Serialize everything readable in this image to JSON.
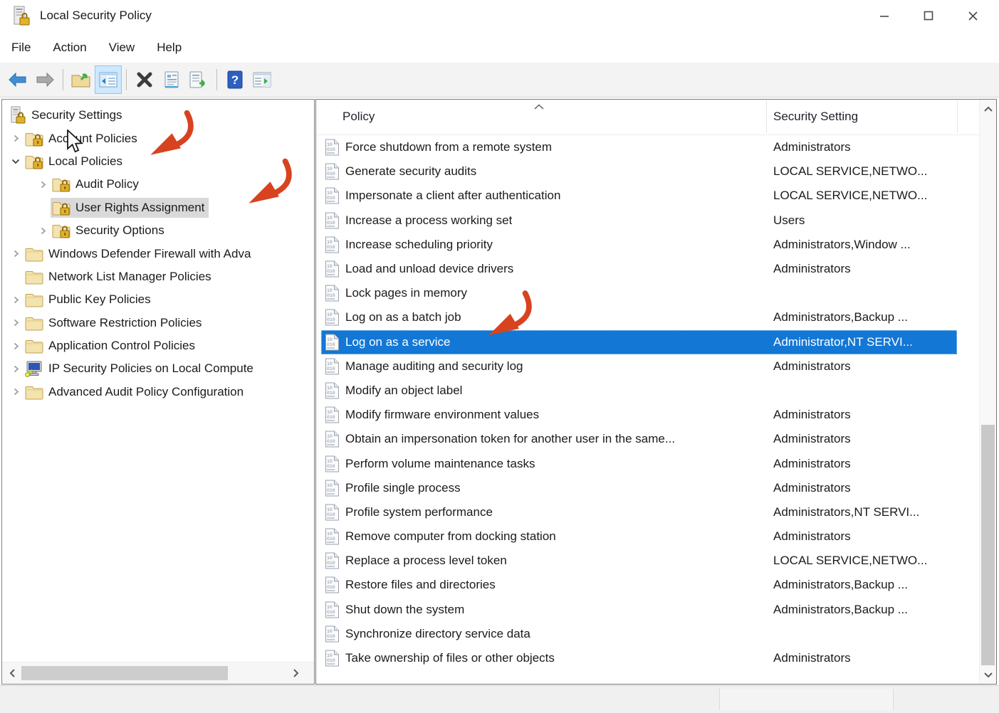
{
  "window": {
    "title": "Local Security Policy",
    "controls": [
      {
        "name": "minimize"
      },
      {
        "name": "maximize"
      },
      {
        "name": "close"
      }
    ]
  },
  "menu": {
    "items": [
      "File",
      "Action",
      "View",
      "Help"
    ]
  },
  "toolbar": {
    "buttons": [
      {
        "type": "button",
        "name": "back"
      },
      {
        "type": "button",
        "name": "forward"
      },
      {
        "type": "separator"
      },
      {
        "type": "button",
        "name": "up-one-level"
      },
      {
        "type": "button",
        "name": "show-console-tree",
        "active": true
      },
      {
        "type": "separator"
      },
      {
        "type": "button",
        "name": "delete"
      },
      {
        "type": "button",
        "name": "properties"
      },
      {
        "type": "button",
        "name": "export-list"
      },
      {
        "type": "separator"
      },
      {
        "type": "button",
        "name": "help"
      },
      {
        "type": "button",
        "name": "show-action-pane"
      }
    ]
  },
  "tree": {
    "items": [
      {
        "label": "Security Settings",
        "level": 0,
        "icon": "security-root",
        "expander": "none",
        "selected": false
      },
      {
        "label": "Account Policies",
        "level": 1,
        "icon": "folder-lock",
        "expander": "collapsed",
        "selected": false
      },
      {
        "label": "Local Policies",
        "level": 1,
        "icon": "folder-lock",
        "expander": "expanded",
        "selected": false
      },
      {
        "label": "Audit Policy",
        "level": 2,
        "icon": "folder-lock",
        "expander": "collapsed",
        "selected": false
      },
      {
        "label": "User Rights Assignment",
        "level": 2,
        "icon": "folder-lock",
        "expander": "none",
        "selected": true
      },
      {
        "label": "Security Options",
        "level": 2,
        "icon": "folder-lock",
        "expander": "collapsed",
        "selected": false
      },
      {
        "label": "Windows Defender Firewall with Adva",
        "level": 1,
        "icon": "folder",
        "expander": "collapsed",
        "selected": false
      },
      {
        "label": "Network List Manager Policies",
        "level": 1,
        "icon": "folder",
        "expander": "none",
        "selected": false
      },
      {
        "label": "Public Key Policies",
        "level": 1,
        "icon": "folder",
        "expander": "collapsed",
        "selected": false
      },
      {
        "label": "Software Restriction Policies",
        "level": 1,
        "icon": "folder",
        "expander": "collapsed",
        "selected": false
      },
      {
        "label": "Application Control Policies",
        "level": 1,
        "icon": "folder",
        "expander": "collapsed",
        "selected": false
      },
      {
        "label": "IP Security Policies on Local Compute",
        "level": 1,
        "icon": "computer-key",
        "expander": "collapsed",
        "selected": false
      },
      {
        "label": "Advanced Audit Policy Configuration",
        "level": 1,
        "icon": "folder",
        "expander": "collapsed",
        "selected": false
      }
    ]
  },
  "list": {
    "columns": {
      "policy": "Policy",
      "setting": "Security Setting"
    },
    "sort": "ascending",
    "rows": [
      {
        "policy": "Force shutdown from a remote system",
        "setting": "Administrators",
        "selected": false
      },
      {
        "policy": "Generate security audits",
        "setting": "LOCAL SERVICE,NETWO...",
        "selected": false
      },
      {
        "policy": "Impersonate a client after authentication",
        "setting": "LOCAL SERVICE,NETWO...",
        "selected": false
      },
      {
        "policy": "Increase a process working set",
        "setting": "Users",
        "selected": false
      },
      {
        "policy": "Increase scheduling priority",
        "setting": "Administrators,Window ...",
        "selected": false
      },
      {
        "policy": "Load and unload device drivers",
        "setting": "Administrators",
        "selected": false
      },
      {
        "policy": "Lock pages in memory",
        "setting": "",
        "selected": false
      },
      {
        "policy": "Log on as a batch job",
        "setting": "Administrators,Backup ...",
        "selected": false
      },
      {
        "policy": "Log on as a service",
        "setting": "Administrator,NT SERVI...",
        "selected": true
      },
      {
        "policy": "Manage auditing and security log",
        "setting": "Administrators",
        "selected": false
      },
      {
        "policy": "Modify an object label",
        "setting": "",
        "selected": false
      },
      {
        "policy": "Modify firmware environment values",
        "setting": "Administrators",
        "selected": false
      },
      {
        "policy": "Obtain an impersonation token for another user in the same...",
        "setting": "Administrators",
        "selected": false
      },
      {
        "policy": "Perform volume maintenance tasks",
        "setting": "Administrators",
        "selected": false
      },
      {
        "policy": "Profile single process",
        "setting": "Administrators",
        "selected": false
      },
      {
        "policy": "Profile system performance",
        "setting": "Administrators,NT SERVI...",
        "selected": false
      },
      {
        "policy": "Remove computer from docking station",
        "setting": "Administrators",
        "selected": false
      },
      {
        "policy": "Replace a process level token",
        "setting": "LOCAL SERVICE,NETWO...",
        "selected": false
      },
      {
        "policy": "Restore files and directories",
        "setting": "Administrators,Backup ...",
        "selected": false
      },
      {
        "policy": "Shut down the system",
        "setting": "Administrators,Backup ...",
        "selected": false
      },
      {
        "policy": "Synchronize directory service data",
        "setting": "",
        "selected": false
      },
      {
        "policy": "Take ownership of files or other objects",
        "setting": "Administrators",
        "selected": false
      }
    ]
  },
  "status_bar": {
    "cells": [
      "",
      "",
      ""
    ]
  },
  "annotations": {
    "arrows": [
      {
        "target": "tree-item-local-policies"
      },
      {
        "target": "tree-item-user-rights-assignment"
      },
      {
        "target": "list-row-log-on-as-a-service"
      }
    ],
    "arrow_color": "#d8431f"
  },
  "colors": {
    "selection_blue": "#1377d5",
    "tree_selection_gray": "#d9d9d9",
    "toolbar_active_bg": "#cde8ff",
    "folder_yellow": "#f3e3ae",
    "lock_gold": "#e3b126"
  }
}
